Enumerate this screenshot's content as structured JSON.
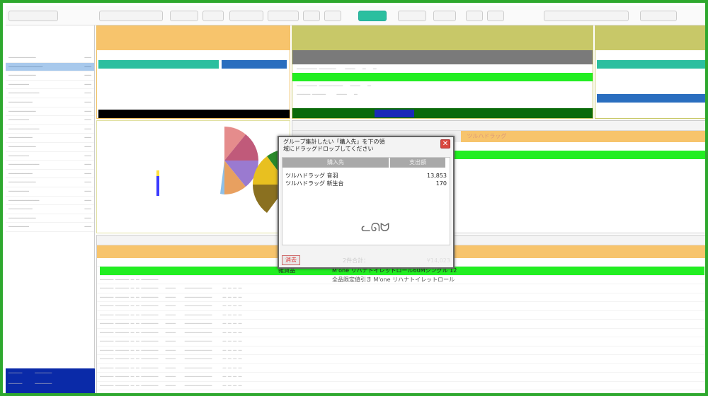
{
  "dialog": {
    "title": "グループ集計したい「購入先」を下の領\n域にドラッグドロップしてください",
    "col_vendor": "購入先",
    "col_amount": "支出額",
    "rows": [
      {
        "vendor": "ツルハドラッグ 音羽",
        "amount": "13,853"
      },
      {
        "vendor": "ツルハドラッグ 新生台",
        "amount": "170"
      }
    ],
    "clear_label": "消去",
    "count_label": "2件合計：",
    "total_amount": "¥14,023"
  },
  "main_grid": {
    "category": "雑貨品",
    "product": "M'one リハナトイレットロール60Mシングル 12",
    "product2": "全品限定値引き M'one リハナトイレットロール"
  },
  "right_panel": {
    "header": "ツルハドラッグ"
  },
  "colors": {
    "frame": "#2ea82e",
    "highlight_row": "#22ee22",
    "orange_header": "#f7c46c",
    "olive_header": "#c8c868",
    "dark_total": "#0a2aa8"
  }
}
